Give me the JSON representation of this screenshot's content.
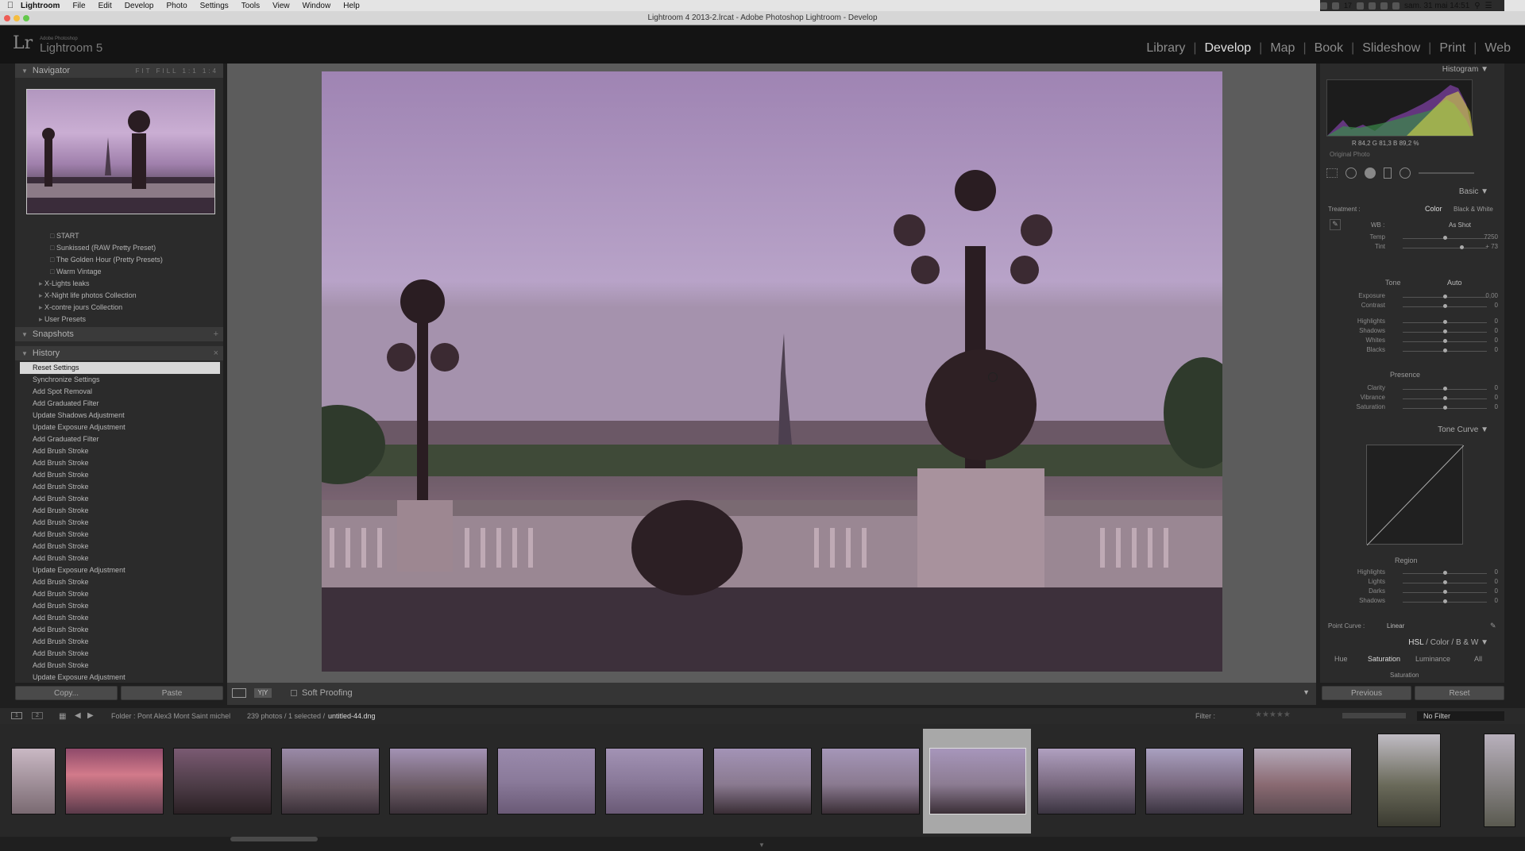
{
  "menubar": {
    "app": "Lightroom",
    "items": [
      "File",
      "Edit",
      "Develop",
      "Photo",
      "Settings",
      "Tools",
      "View",
      "Window",
      "Help"
    ],
    "clock": "sam. 31 mai 14:51",
    "tray_count": "17"
  },
  "window": {
    "title": "Lightroom 4 2013-2.lrcat - Adobe Photoshop Lightroom - Develop"
  },
  "brand": {
    "small": "Adobe Photoshop",
    "name": "Lightroom 5",
    "mark": "Lr"
  },
  "modules": [
    "Library",
    "Develop",
    "Map",
    "Book",
    "Slideshow",
    "Print",
    "Web"
  ],
  "active_module": "Develop",
  "navigator": {
    "title": "Navigator",
    "zoom_options": "FIT  FILL  1:1  1:4"
  },
  "presets": [
    {
      "label": "START",
      "indent": 2
    },
    {
      "label": "Sunkissed (RAW Pretty Preset)",
      "indent": 2
    },
    {
      "label": "The Golden Hour (Pretty Presets)",
      "indent": 2
    },
    {
      "label": "Warm Vintage",
      "indent": 2
    },
    {
      "label": "X-Lights leaks",
      "indent": 1
    },
    {
      "label": "X-Night life  photos Collection",
      "indent": 1
    },
    {
      "label": "X-contre jours Collection",
      "indent": 1
    },
    {
      "label": "User Presets",
      "indent": 1
    }
  ],
  "snapshots": {
    "title": "Snapshots",
    "action": "+"
  },
  "history": {
    "title": "History",
    "action": "×",
    "items": [
      "Reset Settings",
      "Synchronize Settings",
      "Add Spot Removal",
      "Add Graduated Filter",
      "Update Shadows Adjustment",
      "Update Exposure Adjustment",
      "Add Graduated Filter",
      "Add Brush Stroke",
      "Add Brush Stroke",
      "Add Brush Stroke",
      "Add Brush Stroke",
      "Add Brush Stroke",
      "Add Brush Stroke",
      "Add Brush Stroke",
      "Add Brush Stroke",
      "Add Brush Stroke",
      "Add Brush Stroke",
      "Update Exposure Adjustment",
      "Add Brush Stroke",
      "Add Brush Stroke",
      "Add Brush Stroke",
      "Add Brush Stroke",
      "Add Brush Stroke",
      "Add Brush Stroke",
      "Add Brush Stroke",
      "Add Brush Stroke",
      "Update Exposure Adjustment"
    ]
  },
  "left_buttons": {
    "copy": "Copy...",
    "paste": "Paste"
  },
  "toolbar": {
    "soft_proofing": "Soft Proofing"
  },
  "histogram": {
    "title": "Histogram",
    "readout": "R  84,2  G  81,3  B  89,2 %",
    "original": "Original Photo"
  },
  "basic": {
    "title": "Basic",
    "treatment_label": "Treatment :",
    "color": "Color",
    "bw": "Black & White",
    "wb_label": "WB :",
    "wb_value": "As Shot",
    "tone_label": "Tone",
    "auto": "Auto",
    "presence_label": "Presence",
    "sliders": [
      {
        "label": "Temp",
        "value": "7250",
        "pos": 0.5
      },
      {
        "label": "Tint",
        "value": "+ 73",
        "pos": 0.7
      },
      {
        "label": "Exposure",
        "value": "0,00",
        "pos": 0.5
      },
      {
        "label": "Contrast",
        "value": "0",
        "pos": 0.5
      },
      {
        "label": "Highlights",
        "value": "0",
        "pos": 0.5
      },
      {
        "label": "Shadows",
        "value": "0",
        "pos": 0.5
      },
      {
        "label": "Whites",
        "value": "0",
        "pos": 0.5
      },
      {
        "label": "Blacks",
        "value": "0",
        "pos": 0.5
      },
      {
        "label": "Clarity",
        "value": "0",
        "pos": 0.5
      },
      {
        "label": "Vibrance",
        "value": "0",
        "pos": 0.5
      },
      {
        "label": "Saturation",
        "value": "0",
        "pos": 0.5
      }
    ]
  },
  "tone_curve": {
    "title": "Tone Curve",
    "region": "Region",
    "point_curve_label": "Point Curve :",
    "point_curve_value": "Linear",
    "sliders": [
      {
        "label": "Highlights",
        "value": "0",
        "pos": 0.5
      },
      {
        "label": "Lights",
        "value": "0",
        "pos": 0.5
      },
      {
        "label": "Darks",
        "value": "0",
        "pos": 0.5
      },
      {
        "label": "Shadows",
        "value": "0",
        "pos": 0.5
      }
    ]
  },
  "hsl": {
    "title": "HSL",
    "color": "Color",
    "bw": "B & W",
    "tabs": [
      "Hue",
      "Saturation",
      "Luminance",
      "All"
    ],
    "sub": "Saturation"
  },
  "right_buttons": {
    "previous": "Previous",
    "reset": "Reset"
  },
  "filmstrip": {
    "folder": "Folder : Pont Alex3 Mont Saint michel",
    "count": "239 photos / 1 selected /",
    "file": "untitled-44.dng",
    "filter_label": "Filter :",
    "filter_value": "No Filter"
  },
  "colors": {
    "accent": "#e0e0e0",
    "panel": "#2b2b2b",
    "bg": "#1f1f1f"
  }
}
